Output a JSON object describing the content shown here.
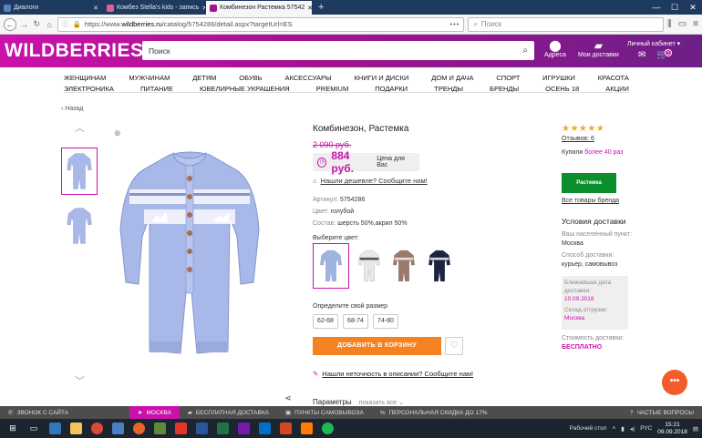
{
  "browser": {
    "tabs": [
      {
        "title": "Диалоги",
        "color": "#5b7fbf"
      },
      {
        "title": "Комбез Stella's kids - запись",
        "color": "#e35d9a"
      },
      {
        "title": "Комбинезон Растемка 57542",
        "color": "#a3128f"
      }
    ],
    "url_prefix": "https://www.",
    "url_host": "wildberries.ru",
    "url_path": "/catalog/5754286/detail.aspx?targetUrl=ES",
    "url_dots": "•••",
    "search_placeholder": "Поиск"
  },
  "header": {
    "logo": "WILDBERRIES",
    "search_placeholder": "Поиск",
    "address_label": "Адреса",
    "delivery_label": "Мои доставки",
    "cabinet_label": "Личный кабинет ▾",
    "cart_count": "2"
  },
  "menu": {
    "row1": [
      "ЖЕНЩИНАМ",
      "МУЖЧИНАМ",
      "ДЕТЯМ",
      "ОБУВЬ",
      "АКСЕССУАРЫ",
      "КНИГИ И ДИСКИ",
      "ДОМ И ДАЧА",
      "СПОРТ",
      "ИГРУШКИ",
      "КРАСОТА"
    ],
    "row2": [
      "ЭЛЕКТРОНИКА",
      "ПИТАНИЕ",
      "ЮВЕЛИРНЫЕ УКРАШЕНИЯ",
      "PREMIUM",
      "ПОДАРКИ",
      "ТРЕНДЫ",
      "БРЕНДЫ",
      "ОСЕНЬ 18",
      "АКЦИИ"
    ]
  },
  "back_label": "Назад",
  "product": {
    "title": "Комбинезон, Растемка",
    "old_price": "2 090 руб.",
    "price": "884 руб.",
    "price_label": "Цена для Вас",
    "cheaper_link": "Нашли дешевле? Сообщите нам!",
    "article_key": "Артикул:",
    "article_val": "5754286",
    "color_key": "Цвет:",
    "color_val": "голубой",
    "composition_key": "Состав:",
    "composition_val": "шерсть 50%,акрил 50%",
    "choose_color": "Выберите цвет:",
    "swatches": [
      {
        "name": "blue",
        "color": "#9fb3e0"
      },
      {
        "name": "white",
        "color": "#e8e8e8"
      },
      {
        "name": "brown",
        "color": "#9a7a6a"
      },
      {
        "name": "navy",
        "color": "#1c2440"
      }
    ],
    "size_label": "Определите свой размер",
    "sizes": [
      "62-68",
      "68-74",
      "74-80"
    ],
    "add_to_cart": "ДОБАВИТЬ В КОРЗИНУ",
    "report_link": "Нашли неточность в описании? Сообщите нам!",
    "params_label": "Параметры",
    "params_show": "показать все ⌄",
    "main_color": "#a8b8e8"
  },
  "sidebar": {
    "reviews": "Отзывов: 6",
    "bought_prefix": "Купили",
    "bought_value": "более 40 раз",
    "brand_logo_text": "Растемка",
    "all_brand": "Все товары бренда",
    "delivery_title": "Условия доставки",
    "pickup_label": "Ваш населенный пункт:",
    "pickup_value": "Москва",
    "method_label": "Способ доставки:",
    "method_value": "курьер, самовывоз",
    "nearest_label": "Ближайшая дата доставки:",
    "nearest_value": "10.09.2018",
    "warehouse_label": "Склад отгрузки:",
    "warehouse_value": "Москва",
    "cost_label": "Стоимость доставки:",
    "cost_value": "БЕСПЛАТНО"
  },
  "footer_bar": {
    "call": "ЗВОНОК С САЙТА",
    "city": "МОСКВА",
    "free_delivery": "БЕСПЛАТНАЯ ДОСТАВКА",
    "pickup_points": "ПУНКТЫ САМОВЫВОЗА",
    "discount": "ПЕРСОНАЛЬНАЯ СКИДКА ДО 17%",
    "faq": "ЧАСТЫЕ ВОПРОСЫ"
  },
  "taskbar": {
    "icons": [
      {
        "name": "edge",
        "color": "#3277bc"
      },
      {
        "name": "folder",
        "color": "#f3c35a"
      },
      {
        "name": "chrome",
        "color": "#d84a3a"
      },
      {
        "name": "mail",
        "color": "#4a7fc1"
      },
      {
        "name": "firefox",
        "color": "#e8662a"
      },
      {
        "name": "photos",
        "color": "#5a8a3a"
      },
      {
        "name": "yandex",
        "color": "#e0362b"
      },
      {
        "name": "word",
        "color": "#2b579a"
      },
      {
        "name": "excel",
        "color": "#217346"
      },
      {
        "name": "onenote",
        "color": "#7719aa"
      },
      {
        "name": "outlook",
        "color": "#0072c6"
      },
      {
        "name": "powerpoint",
        "color": "#d24726"
      },
      {
        "name": "illustrator",
        "color": "#ff7c00"
      },
      {
        "name": "spotify",
        "color": "#1db954"
      }
    ],
    "desktop": "Рабочий стол",
    "lang": "РУС",
    "time": "15:21",
    "date": "09.09.2018"
  }
}
